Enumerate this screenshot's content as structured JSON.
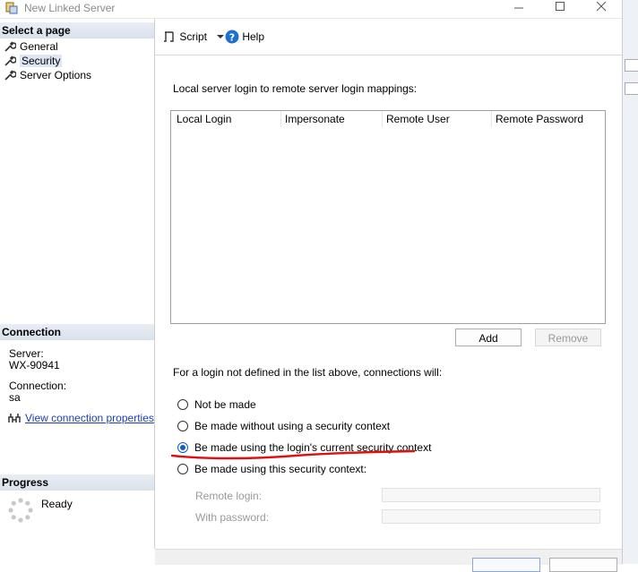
{
  "window": {
    "title": "New Linked Server"
  },
  "left_pane": {
    "select_page_header": "Select a page",
    "pages": [
      {
        "label": "General",
        "icon": "wrench-icon"
      },
      {
        "label": "Security",
        "icon": "wrench-icon",
        "selected": true
      },
      {
        "label": "Server Options",
        "icon": "wrench-icon"
      }
    ],
    "connection_header": "Connection",
    "server_label": "Server:",
    "server_value": "WX-90941",
    "connection_label": "Connection:",
    "connection_value": "sa",
    "view_properties_link": "View connection properties",
    "progress_header": "Progress",
    "progress_status": "Ready"
  },
  "toolbar": {
    "script_label": "Script",
    "help_label": "Help"
  },
  "security": {
    "mappings_label": "Local server login to remote server login mappings:",
    "columns": [
      "Local Login",
      "Impersonate",
      "Remote User",
      "Remote Password"
    ],
    "add_label": "Add",
    "remove_label": "Remove",
    "fallback_label": "For a login not defined in the list above, connections will:",
    "options": [
      {
        "label": "Not be made",
        "checked": false
      },
      {
        "label": "Be made without using a security context",
        "checked": false
      },
      {
        "label": "Be made using the login's current security context",
        "checked": true
      },
      {
        "label": "Be made using this security context:",
        "checked": false
      }
    ],
    "remote_login_label": "Remote login:",
    "remote_login_value": "",
    "with_password_label": "With password:",
    "with_password_value": ""
  },
  "colors": {
    "accent": "#0a5fc6",
    "annotation": "#e01010",
    "link": "#1a3fb8"
  }
}
